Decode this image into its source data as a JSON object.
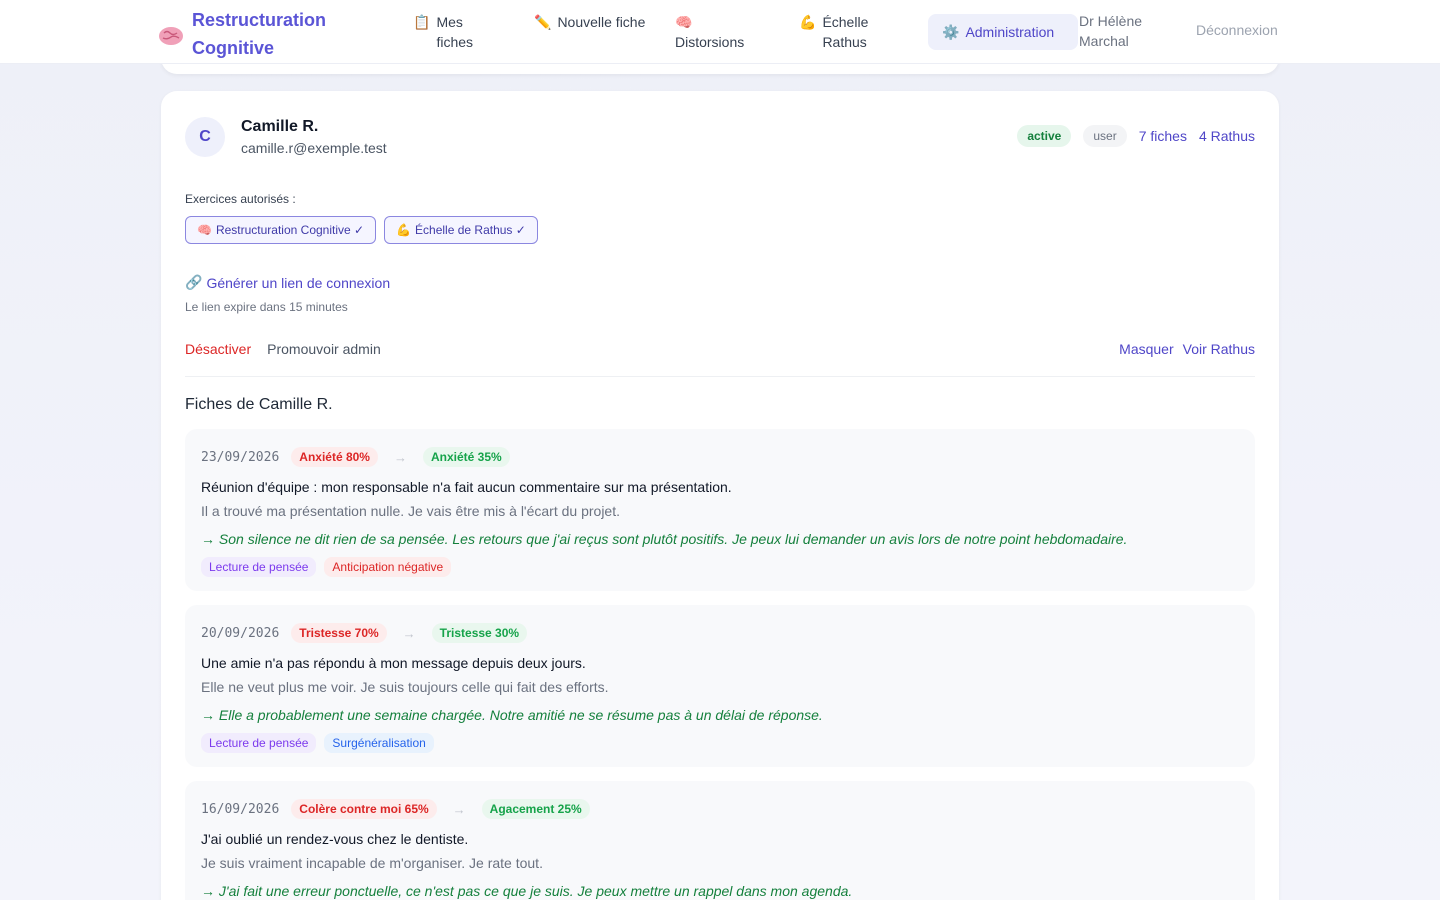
{
  "nav": {
    "brand": "Restructuration Cognitive",
    "items": [
      {
        "icon": "📋",
        "label": "Mes fiches"
      },
      {
        "icon": "✏️",
        "label": "Nouvelle fiche"
      },
      {
        "icon": "🧠",
        "label": "Distorsions"
      },
      {
        "icon": "💪",
        "label": "Échelle Rathus"
      }
    ],
    "active": {
      "icon": "⚙️",
      "label": "Administration"
    },
    "user": "Dr Hélène Marchal",
    "logout": "Déconnexion"
  },
  "user_card": {
    "initial": "C",
    "name": "Camille R.",
    "email": "camille.r@exemple.test",
    "status": "active",
    "role": "user",
    "fiches_count": "7 fiches",
    "rathus_count": "4 Rathus",
    "exercises_label": "Exercices autorisés :",
    "exercises": [
      {
        "icon": "🧠",
        "label": "Restructuration Cognitive ✓"
      },
      {
        "icon": "💪",
        "label": "Échelle de Rathus ✓"
      }
    ],
    "gen_link_icon": "🔗",
    "gen_link": "Générer un lien de connexion",
    "gen_link_sub": "Le lien expire dans 15 minutes",
    "deactivate": "Désactiver",
    "promote": "Promouvoir admin",
    "hide": "Masquer",
    "view_rathus": "Voir Rathus",
    "fiches_title": "Fiches de Camille R."
  },
  "fiches": [
    {
      "date": "23/09/2026",
      "before": "Anxiété 80%",
      "arrow": "→",
      "after": "Anxiété 35%",
      "situation": "Réunion d'équipe : mon responsable n'a fait aucun commentaire sur ma présentation.",
      "thought": "Il a trouvé ma présentation nulle. Je vais être mis à l'écart du projet.",
      "alternative": "→ Son silence ne dit rien de sa pensée. Les retours que j'ai reçus sont plutôt positifs. Je peux lui demander un avis lors de notre point hebdomadaire.",
      "tags": [
        {
          "label": "Lecture de pensée",
          "color": "purple"
        },
        {
          "label": "Anticipation négative",
          "color": "red"
        }
      ]
    },
    {
      "date": "20/09/2026",
      "before": "Tristesse 70%",
      "arrow": "→",
      "after": "Tristesse 30%",
      "situation": "Une amie n'a pas répondu à mon message depuis deux jours.",
      "thought": "Elle ne veut plus me voir. Je suis toujours celle qui fait des efforts.",
      "alternative": "→ Elle a probablement une semaine chargée. Notre amitié ne se résume pas à un délai de réponse.",
      "tags": [
        {
          "label": "Lecture de pensée",
          "color": "purple"
        },
        {
          "label": "Surgénéralisation",
          "color": "blue"
        }
      ]
    },
    {
      "date": "16/09/2026",
      "before": "Colère contre moi 65%",
      "arrow": "→",
      "after": "Agacement 25%",
      "situation": "J'ai oublié un rendez-vous chez le dentiste.",
      "thought": "Je suis vraiment incapable de m'organiser. Je rate tout.",
      "alternative": "→ J'ai fait une erreur ponctuelle, ce n'est pas ce que je suis. Je peux mettre un rappel dans mon agenda.",
      "tags": []
    }
  ]
}
